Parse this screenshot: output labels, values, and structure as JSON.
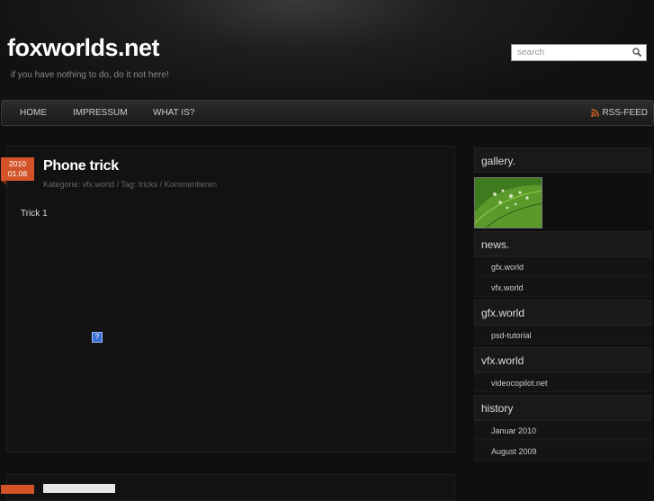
{
  "header": {
    "site_title": "foxworlds.net",
    "tagline": "if you have nothing to do, do it not here!",
    "search_placeholder": "search"
  },
  "nav": {
    "items": [
      "HOME",
      "IMPRESSUM",
      "WHAT IS?"
    ],
    "rss_label": "RSS-FEED"
  },
  "post": {
    "date_year": "2010",
    "date_day": "01.08",
    "title": "Phone trick",
    "meta": {
      "category_label": "Kategorie:",
      "category": "vfx.world",
      "tag_label": "Tag:",
      "tag": "tricks",
      "comments": "Kommentieren"
    },
    "body": "Trick 1",
    "broken_image_glyph": "?"
  },
  "sidebar": {
    "gallery_heading": "gallery.",
    "news_heading": "news.",
    "news_links": [
      "gfx.world",
      "vfx.world"
    ],
    "gfx_heading": "gfx.world",
    "gfx_links": [
      "psd-tutorial"
    ],
    "vfx_heading": "vfx.world",
    "vfx_links": [
      "videocopilot.net"
    ],
    "history_heading": "history",
    "history_links": [
      "Januar 2010",
      "August 2009"
    ]
  },
  "colors": {
    "accent": "#d4542a",
    "rss": "#e8691f",
    "background": "#0f0f0f"
  }
}
